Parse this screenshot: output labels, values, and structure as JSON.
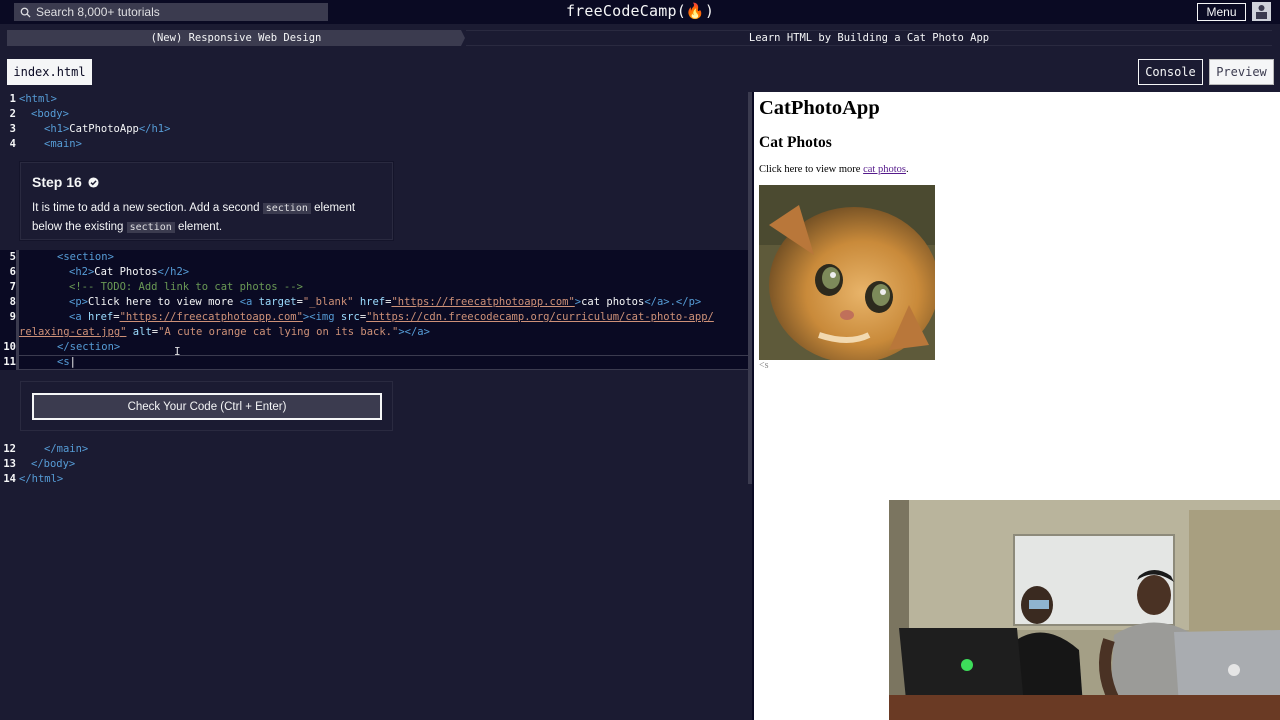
{
  "topnav": {
    "search_placeholder": "Search 8,000+ tutorials",
    "brand": "freeCodeCamp(🔥)",
    "menu_label": "Menu"
  },
  "breadcrumb": {
    "course": "(New) Responsive Web Design",
    "lesson": "Learn HTML by Building a Cat Photo App"
  },
  "tabs": {
    "file": "index.html",
    "console": "Console",
    "preview": "Preview"
  },
  "step": {
    "title": "Step 16",
    "desc_1": "It is time to add a new section. Add a second ",
    "desc_code_1": "section",
    "desc_2": " element below the existing ",
    "desc_code_2": "section",
    "desc_3": " element."
  },
  "check_button": "Check Your Code (Ctrl + Enter)",
  "editor": {
    "line_numbers": [
      "1",
      "2",
      "3",
      "4",
      "5",
      "6",
      "7",
      "8",
      "9",
      "10",
      "11",
      "12",
      "13",
      "14"
    ],
    "code": {
      "l1": "<html>",
      "l2": "<body>",
      "l3_open": "<h1>",
      "l3_text": "CatPhotoApp",
      "l3_close": "</h1>",
      "l4": "<main>",
      "l5": "<section>",
      "l6_open": "<h2>",
      "l6_text": "Cat Photos",
      "l6_close": "</h2>",
      "l7": "<!-- TODO: Add link to cat photos -->",
      "l8_p": "<p>",
      "l8_text": "Click here to view more ",
      "l8_a": "<a ",
      "l8_target": "target",
      "l8_target_val": "\"_blank\"",
      "l8_href": "href",
      "l8_href_val": "\"https://freecatphotoapp.com\"",
      "l8_gt": ">",
      "l8_link": "cat photos",
      "l8_close": "</a>.</p>",
      "l9_a": "<a ",
      "l9_href": "href",
      "l9_href_val": "\"https://freecatphotoapp.com\"",
      "l9_img": "><img ",
      "l9_src": "src",
      "l9_src_val": "\"https://cdn.freecodecamp.org/curriculum/cat-photo-app/",
      "l9b_src_val": "relaxing-cat.jpg\"",
      "l9b_alt": "alt",
      "l9b_alt_val": "\"A cute orange cat lying on its back.\"",
      "l9b_close": "></a>",
      "l10": "</section>",
      "l11": "<s",
      "l12": "</main>",
      "l13": "</body>",
      "l14": "</html>"
    }
  },
  "preview": {
    "h1": "CatPhotoApp",
    "h2": "Cat Photos",
    "p_text": "Click here to view more ",
    "p_link": "cat photos",
    "p_end": ".",
    "stray": "<s",
    "img_alt": "A cute orange cat lying on its back."
  },
  "colors": {
    "bg": "#1b1b32",
    "nav": "#0a0a23",
    "accent_gray": "#3b3b4f",
    "text": "#f5f6f7"
  },
  "icons": [
    "search-icon",
    "flame-icon",
    "avatar-icon",
    "check-circle-icon",
    "text-cursor-icon"
  ]
}
